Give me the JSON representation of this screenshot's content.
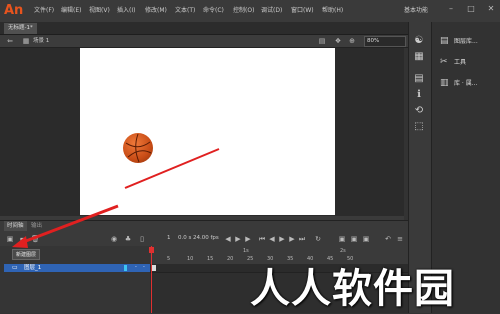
{
  "app": {
    "logo": "An",
    "workspace": "基本功能",
    "logo_color": "#e8541e"
  },
  "menu": [
    "文件(F)",
    "编辑(E)",
    "视图(V)",
    "插入(I)",
    "修改(M)",
    "文本(T)",
    "命令(C)",
    "控制(O)",
    "调试(D)",
    "窗口(W)",
    "帮助(H)"
  ],
  "document": {
    "tab": "无标题-1*",
    "scene": "场景 1",
    "zoom": "80%"
  },
  "timeline": {
    "tabs": [
      "时间轴",
      "输出"
    ],
    "tooltip": "新建图层",
    "layer_name": "图层_1",
    "ruler_seconds": [
      "1s",
      "2s"
    ],
    "ruler_frames": [
      "5",
      "10",
      "15",
      "20",
      "25",
      "30",
      "35",
      "40",
      "45",
      "50"
    ],
    "fps": "24.00 fps",
    "time": "0.0 s",
    "frame": "1"
  },
  "panels": [
    {
      "icon": "library-icon",
      "label": "图层库..."
    },
    {
      "icon": "tools-icon",
      "label": "工具"
    },
    {
      "icon": "library-icon",
      "label": "库 · 属..."
    }
  ],
  "watermark": "人人软件园",
  "colors": {
    "accent": "#e8541e",
    "layer_selected": "#2f64b5",
    "playhead": "#e03030",
    "arrow": "#e02020"
  }
}
